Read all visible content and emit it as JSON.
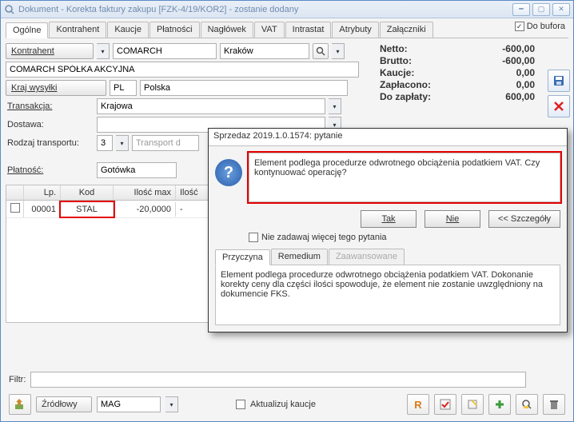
{
  "window": {
    "title": "Dokument - Korekta faktury zakupu [FZK-4/19/KOR2]  - zostanie dodany"
  },
  "tabs": [
    "Ogólne",
    "Kontrahent",
    "Kaucje",
    "Płatności",
    "Nagłówek",
    "VAT",
    "Intrastat",
    "Atrybuty",
    "Załączniki"
  ],
  "do_bufora_label": "Do bufora",
  "kontrahent_btn": "Kontrahent",
  "kontrahent_code": "COMARCH",
  "kontrahent_city": "Kraków",
  "kontrahent_full": "COMARCH SPÓŁKA AKCYJNA",
  "kraj_btn": "Kraj wysyłki",
  "kraj_code": "PL",
  "kraj_name": "Polska",
  "transakcja_lbl": "Transakcja:",
  "transakcja_val": "Krajowa",
  "dostawa_lbl": "Dostawa:",
  "rodzaj_lbl": "Rodzaj transportu:",
  "rodzaj_val": "3",
  "rodzaj_desc": "Transport d",
  "platnosc_lbl": "Płatność:",
  "platnosc_val": "Gotówka",
  "totals": {
    "netto_lbl": "Netto:",
    "netto_val": "-600,00",
    "brutto_lbl": "Brutto:",
    "brutto_val": "-600,00",
    "kaucje_lbl": "Kaucje:",
    "kaucje_val": "0,00",
    "zaplacono_lbl": "Zapłacono:",
    "zaplacono_val": "0,00",
    "dozaplaty_lbl": "Do zapłaty:",
    "dozaplaty_val": "600,00"
  },
  "table": {
    "headers": {
      "lp": "Lp.",
      "kod": "Kod",
      "iloscmax": "Ilość max",
      "ilosc": "Ilość"
    },
    "row": {
      "lp": "00001",
      "kod": "STAL",
      "iloscmax": "-20,0000",
      "ilosc": "-"
    }
  },
  "filtr_lbl": "Filtr:",
  "zrodlowy_lbl": "Źródłowy",
  "zrodlowy_val": "MAG",
  "aktualizuj_lbl": "Aktualizuj kaucje",
  "dialog": {
    "title": "Sprzedaz 2019.1.0.1574: pytanie",
    "message": "Element podlega procedurze odwrotnego obciążenia podatkiem VAT. Czy kontynuować operację?",
    "tak": "Tak",
    "nie": "Nie",
    "szczegoly": "<< Szczegóły",
    "nocheck": "Nie zadawaj więcej tego pytania",
    "subtabs": [
      "Przyczyna",
      "Remedium",
      "Zaawansowane"
    ],
    "detail": "Element podlega procedurze odwrotnego obciążenia podatkiem VAT. Dokonanie korekty ceny dla części ilości spowoduje, że element nie zostanie uwzględniony na dokumencie FKS."
  }
}
